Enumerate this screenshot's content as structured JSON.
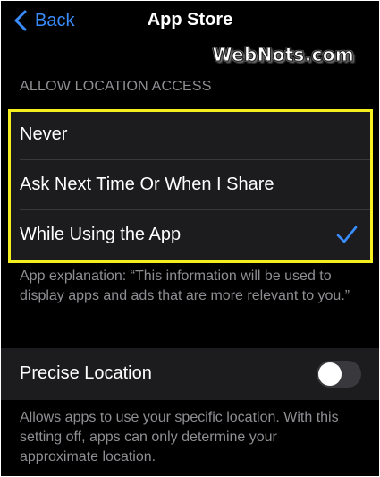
{
  "nav": {
    "back_label": "Back",
    "title": "App Store",
    "back_icon": "chevron-left-icon"
  },
  "watermark": "WebNots.com",
  "location": {
    "section_header": "ALLOW LOCATION ACCESS",
    "options": [
      {
        "label": "Never",
        "selected": false
      },
      {
        "label": "Ask Next Time Or When I Share",
        "selected": false
      },
      {
        "label": "While Using the App",
        "selected": true
      }
    ],
    "selected_icon": "checkmark-icon",
    "explanation": "App explanation: “This information will be used to display apps and ads that are more relevant to you.”"
  },
  "precise": {
    "label": "Precise Location",
    "enabled": false,
    "description": "Allows apps to use your specific location. With this setting off, apps can only determine your approximate location."
  },
  "colors": {
    "accent": "#3a8dff",
    "highlight": "#f4ef1f",
    "background": "#000000",
    "group_background": "#1c1c1e",
    "secondary_text": "#8e8e93"
  }
}
